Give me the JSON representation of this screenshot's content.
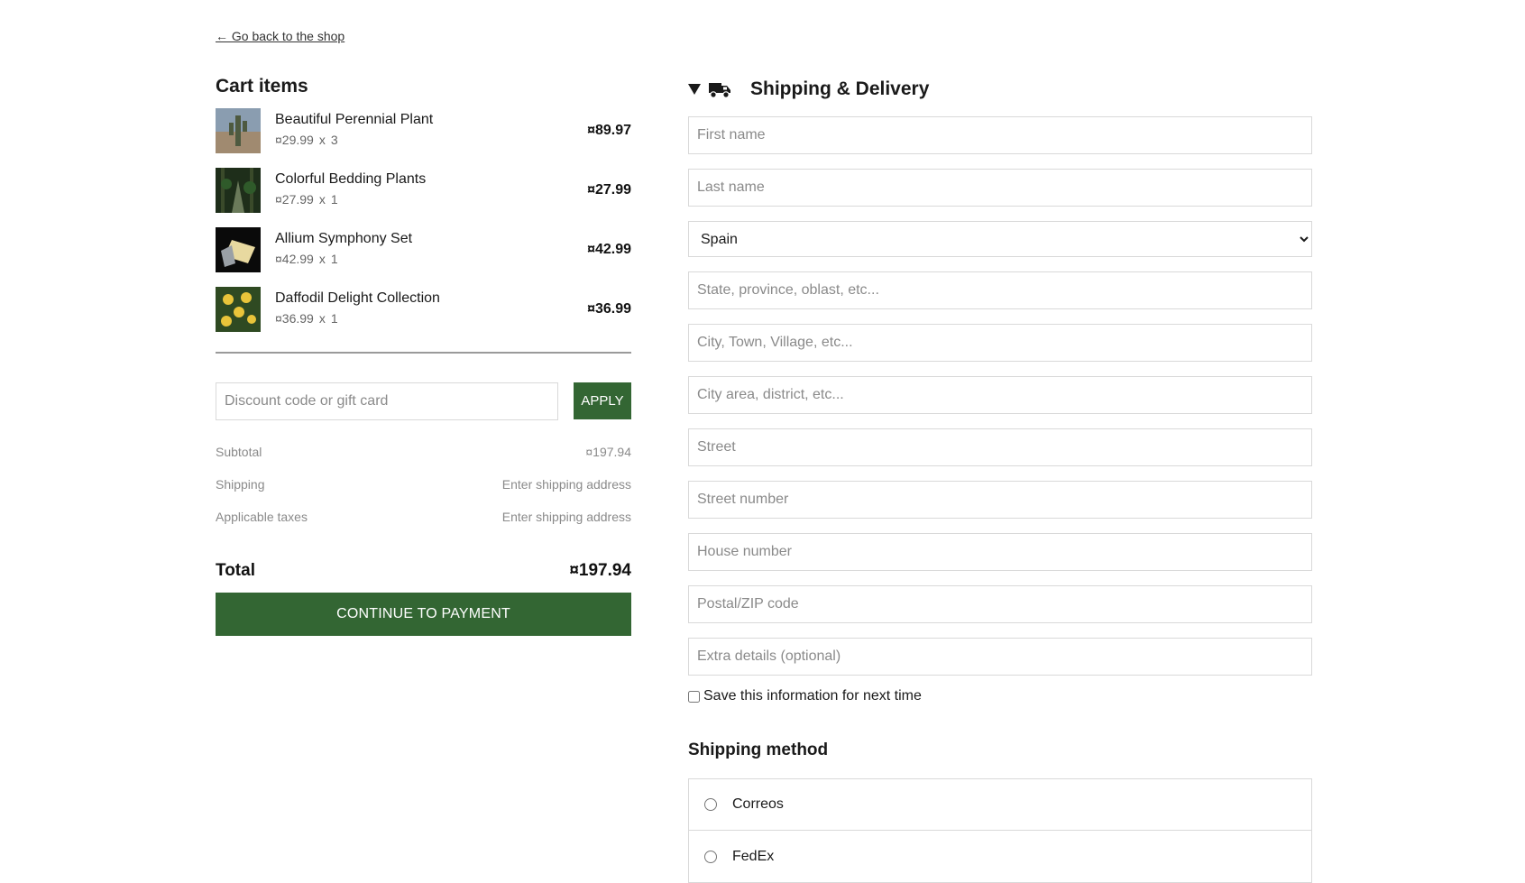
{
  "back_link": "← Go back to the shop",
  "cart": {
    "title": "Cart items",
    "items": [
      {
        "name": "Beautiful Perennial Plant",
        "unit_price": "¤29.99",
        "x": "x",
        "qty": "3",
        "total": "¤89.97",
        "thumb": "cactus-thumbnail"
      },
      {
        "name": "Colorful Bedding Plants",
        "unit_price": "¤27.99",
        "x": "x",
        "qty": "1",
        "total": "¤27.99",
        "thumb": "forest-thumbnail"
      },
      {
        "name": "Allium Symphony Set",
        "unit_price": "¤42.99",
        "x": "x",
        "qty": "1",
        "total": "¤42.99",
        "thumb": "gold-bar-thumbnail"
      },
      {
        "name": "Daffodil Delight Collection",
        "unit_price": "¤36.99",
        "x": "x",
        "qty": "1",
        "total": "¤36.99",
        "thumb": "daffodil-thumbnail"
      }
    ],
    "discount_placeholder": "Discount code or gift card",
    "apply_label": "APPLY",
    "summary": {
      "subtotal_label": "Subtotal",
      "subtotal_value": "¤197.94",
      "shipping_label": "Shipping",
      "shipping_value": "Enter shipping address",
      "taxes_label": "Applicable taxes",
      "taxes_value": "Enter shipping address"
    },
    "total_label": "Total",
    "total_value": "¤197.94",
    "pay_label": "CONTINUE TO PAYMENT"
  },
  "shipping": {
    "title": "Shipping & Delivery",
    "icon": "truck-icon",
    "fields": {
      "first_name": "First name",
      "last_name": "Last name",
      "country": "Spain",
      "state": "State, province, oblast, etc...",
      "city": "City, Town, Village, etc...",
      "area": "City area, district, etc...",
      "street": "Street",
      "street_number": "Street number",
      "house_number": "House number",
      "postal": "Postal/ZIP code",
      "extra": "Extra details (optional)"
    },
    "save_label": "Save this information for next time",
    "method_title": "Shipping method",
    "methods": [
      "Correos",
      "FedEx"
    ]
  },
  "colors": {
    "accent": "#336633"
  }
}
